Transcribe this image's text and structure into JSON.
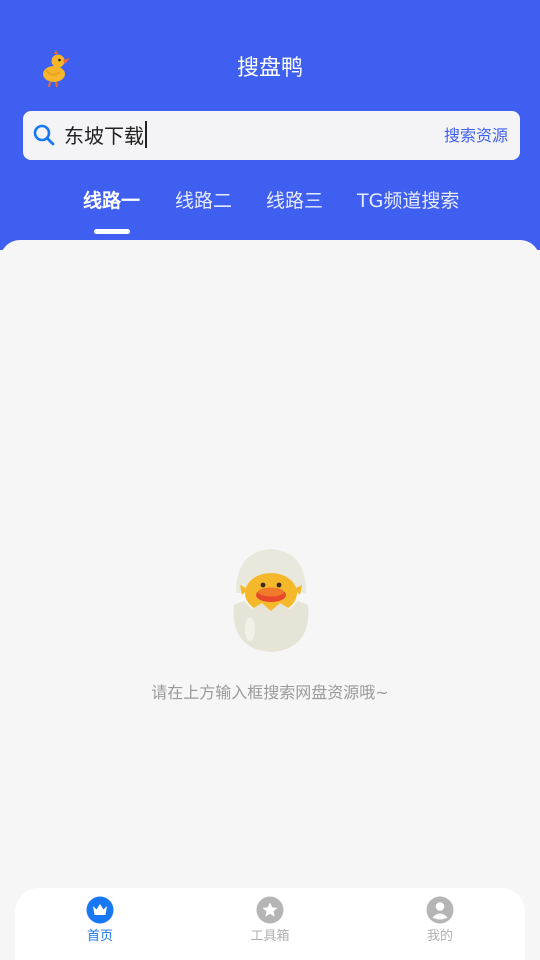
{
  "header": {
    "title": "搜盘鸭",
    "logo_icon": "duck-logo-icon",
    "background_color": "#3f5ff0"
  },
  "search": {
    "value": "东坡下载",
    "icon": "search-icon",
    "button_label": "搜索资源"
  },
  "tabs": [
    {
      "label": "线路一",
      "active": true
    },
    {
      "label": "线路二",
      "active": false
    },
    {
      "label": "线路三",
      "active": false
    },
    {
      "label": "TG频道搜索",
      "active": false
    }
  ],
  "empty_state": {
    "illustration": "duckling-in-egg-icon",
    "text": "请在上方输入框搜索网盘资源哦~"
  },
  "bottom_nav": [
    {
      "label": "首页",
      "icon": "crown-icon",
      "active": true,
      "color": "#1877f2"
    },
    {
      "label": "工具箱",
      "icon": "star-icon",
      "active": false,
      "color": "#b0b0b0"
    },
    {
      "label": "我的",
      "icon": "user-icon",
      "active": false,
      "color": "#b0b0b0"
    }
  ]
}
